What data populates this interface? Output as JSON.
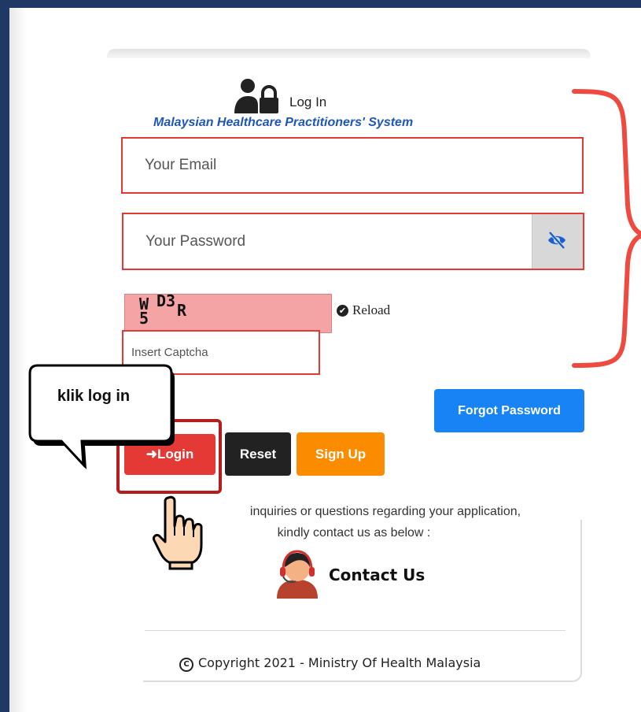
{
  "login": {
    "title": "Log In",
    "system_name": "Malaysian Healthcare Practitioners' System",
    "email_placeholder": "Your Email",
    "password_placeholder": "Your Password",
    "captcha_text": "W5D3R",
    "reload_label": "Reload",
    "captcha_placeholder": "Insert Captcha"
  },
  "buttons": {
    "forgot_password": "Forgot Password",
    "login": "Login",
    "login_icon": "sign-in-icon",
    "reset": "Reset",
    "sign_up": "Sign Up"
  },
  "annotation": {
    "callout": "klik log in",
    "pointer": "pointing-hand-icon"
  },
  "inquiry": {
    "line1": "inquiries or questions regarding your application,",
    "line2": "kindly contact us as below :"
  },
  "contact": {
    "label": "Contact Us",
    "icon": "headset-support-icon"
  },
  "footer": {
    "copyright": "Copyright 2021 - Ministry Of Health Malaysia"
  },
  "colors": {
    "frame": "#1f3864",
    "highlight_red": "#e53935",
    "forgot_blue": "#1783f5",
    "login_red": "#e53935",
    "reset_black": "#222222",
    "signup_orange": "#fb8c00",
    "title_blue": "#1f57b8"
  }
}
